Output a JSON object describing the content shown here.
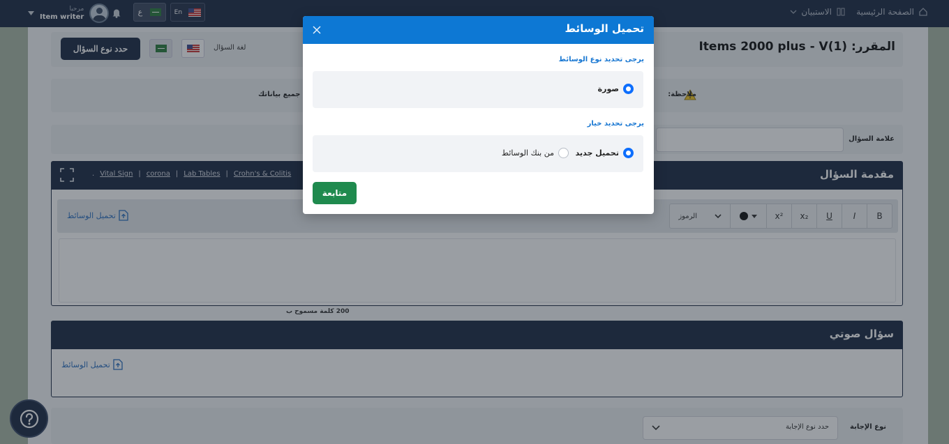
{
  "topbar": {
    "home_label": "الصفحة الرئيسية",
    "survey_label": "الاستبيان",
    "greeting": "مرحبا",
    "user_name": "Item writer",
    "lang_ar": "ع",
    "lang_en": "En"
  },
  "page": {
    "course_title": "المقرر: Items 2000 plus - V(1)",
    "define_question_button": "حدد نوع السؤال",
    "question_language_label": "لغة السؤال",
    "note_prefix": "ملاحظة:",
    "note_tail": "جميع بياناتك",
    "question_mark_label": "علامة السؤال",
    "intro_title": "مقدمة السؤال",
    "intro_links": [
      "Vital Sign",
      "corona",
      "Lab Tables",
      "Crohn's & Colitis"
    ],
    "link_separator": "|",
    "link_dot": ".",
    "toolbar": {
      "bold": "B",
      "italic": "I",
      "underline": "U",
      "subscript": "x₂",
      "superscript": "x²",
      "symbols": "الرموز"
    },
    "upload_media": "تحميل الوسائط",
    "word_limit": "200 كلمة مسموح ب",
    "audio_title": "سؤال صوتي",
    "answer_type_label": "نوع الإجابة",
    "answer_type_placeholder": "حدد نوع الإجابة"
  },
  "modal": {
    "title": "تحميل الوسائط",
    "media_type_prompt": "يرجى تحديد نوع الوسائط",
    "media_type_option": "صورة",
    "choice_prompt": "يرجى تحديد خيار",
    "option_new_upload": "تحميل جديد",
    "option_media_bank": "من بنك الوسائط",
    "continue_button": "متابعة"
  },
  "colors": {
    "navy": "#1d2a44",
    "modal_header": "#0d78d4",
    "continue_green": "#1f8a4e",
    "radio_selected": "#0d6efd"
  }
}
